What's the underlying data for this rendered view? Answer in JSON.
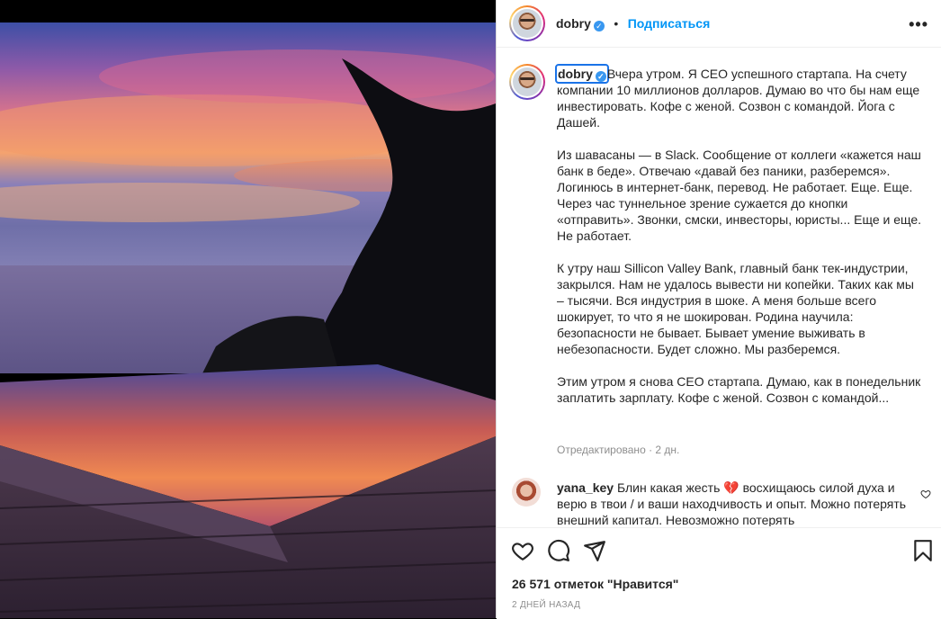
{
  "post": {
    "username": "dobry",
    "verified_icon": "verified-badge-icon",
    "dot": "•",
    "follow_label": "Подписаться",
    "more_label": "•••",
    "caption_body": "Вчера утром. Я CEO успешного стартапа. На счету компании 10 миллионов долларов. Думаю во что бы нам еще инвестировать. Кофе с женой. Созвон с командой. Йога с Дашей.\n\nИз шавасаны — в Slack. Сообщение от коллеги «кажется наш банк в беде». Отвечаю «давай без паники, разберемся». Логинюсь в интернет-банк, перевод. Не работает. Еще. Еще. Через час туннельное зрение сужается до кнопки «отправить». Звонки, смски, инвесторы, юристы... Еще и еще. Не работает.\n\nК утру наш Sillicon Valley Bank, главный банк тек-индустрии, закрылся. Нам не удалось вывести ни копейки. Таких как мы – тысячи. Вся индустрия в шоке. А меня больше всего шокирует, то что я не шокирован. Родина научила: безопасности не бывает. Бывает умение выживать в небезопасности. Будет сложно. Мы разберемся.\n\nЭтим утром я снова CEO стартапа. Думаю, как в понедельник заплатить зарплату. Кофе с женой. Созвон с командой...",
    "edited_label": "Отредактировано · 2 дн.",
    "likes": "26 571 отметок \"Нравится\"",
    "date": "2 ДНЕЙ НАЗАД"
  },
  "comment": {
    "username": "yana_key",
    "text": "Блин какая жесть 💔 восхищаюсь силой духа и верю в твои / и ваши находчивость и опыт. Можно потерять внешний капитал. Невозможно потерять"
  },
  "icons": {
    "like": "heart-icon",
    "comment": "comment-icon",
    "share": "share-icon",
    "save": "bookmark-icon",
    "comment_like": "heart-small-icon"
  },
  "colors": {
    "accent": "#0095f6",
    "verified": "#3897f0",
    "muted": "#8e8e8e"
  }
}
